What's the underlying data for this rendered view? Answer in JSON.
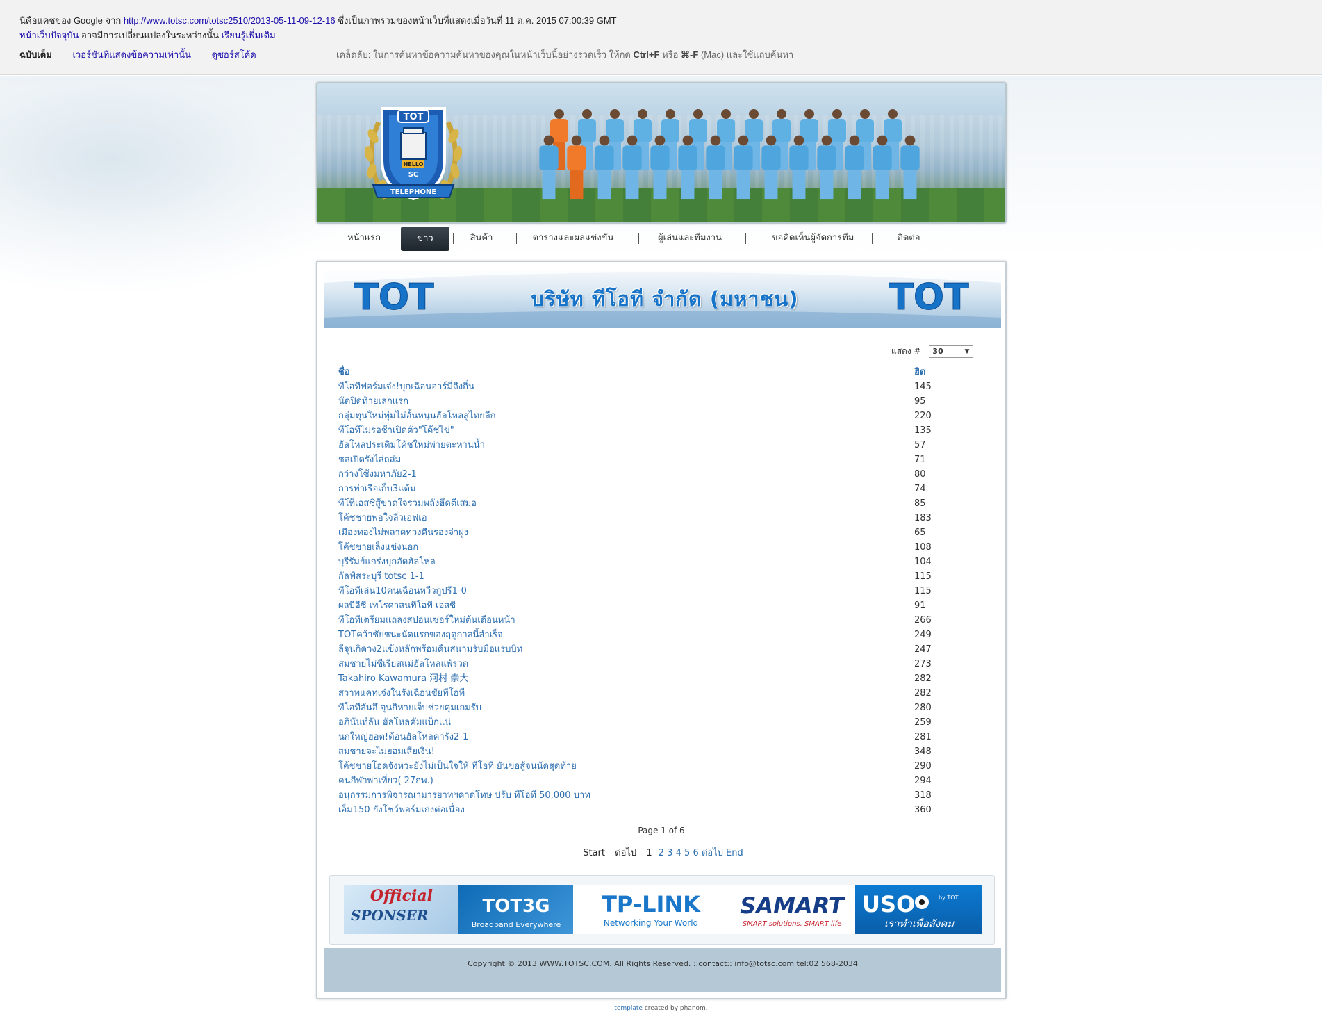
{
  "cache": {
    "prefix": "นี่คือแคชของ Google จาก",
    "url": "http://www.totsc.com/totsc2510/2013-05-11-09-12-16",
    "suffix": "ซึ่งเป็นภาพรวมของหน้าเว็บที่แสดงเมื่อวันที่ 11 ต.ค. 2015 07:00:39 GMT",
    "current_page_link": "หน้าเว็บปัจจุบัน",
    "current_page_text": "อาจมีการเปลี่ยนแปลงในระหว่างนั้น",
    "learn_more": "เรียนรู้เพิ่มเติม",
    "tabs": [
      "ฉบับเต็ม",
      "เวอร์ชันที่แสดงข้อความเท่านั้น",
      "ดูซอร์สโค้ด"
    ],
    "tip_prefix": "เคล็ดลับ: ในการค้นหาข้อความค้นหาของคุณในหน้าเว็บนี้อย่างรวดเร็ว ให้กด",
    "tip_key1": "Ctrl+F",
    "tip_or": "หรือ",
    "tip_key2": "⌘-F",
    "tip_suffix": "(Mac) และใช้แถบค้นหา"
  },
  "banner": {
    "logo_top": "TOT",
    "logo_mid1": "HELLO",
    "logo_mid2": "SC",
    "logo_ribbon": "TELEPHONE"
  },
  "nav": {
    "items": [
      "หน้าแรก",
      "ข่าว",
      "สินค้า",
      "ตารางและผลแข่งขัน",
      "ผู้เล่นและทีมงาน",
      "ขอคิดเห็นผู้จัดการทีม",
      "ติดต่อ"
    ],
    "active_index": 1
  },
  "header_banner": {
    "title": "บริษัท ทีโอที จำกัด (มหาชน)",
    "logo_left": "TOT",
    "logo_right": "TOT"
  },
  "display": {
    "label": "แสดง #",
    "value": "30"
  },
  "table": {
    "col_title": "ชื่อ",
    "col_hits": "ฮิต",
    "rows": [
      {
        "title": "ทีโอทีฟอร์มเจ๋ง!บุกเฉือนอาร์มี่ถึงถิ่น",
        "hits": "145"
      },
      {
        "title": "นัดปิดท้ายเลกแรก",
        "hits": "95"
      },
      {
        "title": "กลุ่มทุนใหม่ทุ่มไม่อั้นหนุนฮัลโหลสู่ไทยลีก",
        "hits": "220"
      },
      {
        "title": "ทีโอทีไม่รอช้าเปิดตัว\"โค้ชไข่\"",
        "hits": "135"
      },
      {
        "title": "ฮัลโหลประเดิมโค้ชใหม่พ่ายตะหานน้ำ",
        "hits": "57"
      },
      {
        "title": "ชลเปิดรังไล่ถล่ม",
        "hits": "71"
      },
      {
        "title": "กว่างโซ้งมหาภัย2-1",
        "hits": "80"
      },
      {
        "title": "การท่าเรือเก็บ3แต้ม",
        "hits": "74"
      },
      {
        "title": "ทีโท็เอสซีสู้ขาดใจรวมพลังฮึดตีเสมอ",
        "hits": "85"
      },
      {
        "title": "โค้ชชายพอใจลิ่วเอฟเอ",
        "hits": "183"
      },
      {
        "title": "เมืองทองไม่พลาดทวงคืนรองจ่าฝูง",
        "hits": "65"
      },
      {
        "title": "โค้ชชายเล็งแข่งนอก",
        "hits": "108"
      },
      {
        "title": "บุรีรัมย์แกร่งบุกอัดฮัลโหล",
        "hits": "104"
      },
      {
        "title": "กัลฟ์สระบุรี totsc 1-1",
        "hits": "115"
      },
      {
        "title": "ทีโอทีเล่น10คนเฉือนหวีวกูปรี1-0",
        "hits": "115"
      },
      {
        "title": "ผลบีอีซี เทโรศาสนทีโอที เอสซี",
        "hits": "91"
      },
      {
        "title": "ทีโอทีเตรียมแถลงสปอนเซอร์ใหม่ต้นเดือนหน้า",
        "hits": "266"
      },
      {
        "title": "TOTคว้าชัยชนะนัดแรกของฤดูกาลนี้สำเร็จ",
        "hits": "249"
      },
      {
        "title": "ลีจุนกิควง2แข้งหลักพร้อมคืนสนามรับมือแรบบิท",
        "hits": "247"
      },
      {
        "title": "สมชายไม่ซีเรียสแม่ฮัลโหลแพ้รวด",
        "hits": "273"
      },
      {
        "title": "Takahiro Kawamura 河村 崇大",
        "hits": "282"
      },
      {
        "title": "สวาทแคทเจ๋งในรังเฉือนชัยทีโอที",
        "hits": "282"
      },
      {
        "title": "ทีโอทีลันอึ จุนกิหายเจ็บช่วยคุมเกมรับ",
        "hits": "280"
      },
      {
        "title": "อภินันท์ลัน ฮัลโหลคัมแบ็กแน่",
        "hits": "259"
      },
      {
        "title": "นกใหญ่ฮอต!ต้อนฮัลโหลคารัง2-1",
        "hits": "281"
      },
      {
        "title": "สมชายจะไม่ยอมเสียเงิน!",
        "hits": "348"
      },
      {
        "title": "โค้ชชายโอดจังหวะยังไม่เป็นใจให้ ทีโอที ยันขอสู้จนนัดสุดท้าย",
        "hits": "290"
      },
      {
        "title": "คนกีฬาพาเที่ยว( 27กพ.)",
        "hits": "294"
      },
      {
        "title": "อนุกรรมการพิจารณามารยาทฯคาดโทษ ปรับ ทีโอที 50,000 บาท",
        "hits": "318"
      },
      {
        "title": "เอ็ม150 ยังโชว์ฟอร์มเก่งต่อเนื่อง",
        "hits": "360"
      }
    ]
  },
  "pagination": {
    "counter": "Page 1 of 6",
    "start": "Start",
    "prev": "ต่อไป",
    "pages": [
      "1",
      "2",
      "3",
      "4",
      "5",
      "6"
    ],
    "current": "1",
    "next": "ต่อไป",
    "end": "End"
  },
  "sponsors": {
    "official_line1": "Official",
    "official_line2": "SPONSER",
    "tot3g": "TOT3G",
    "tot3g_sub": "Broadband Everywhere",
    "tplink": "TP-LINK",
    "tplink_sub": "Networking Your World",
    "samart": "SAMART",
    "samart_sub": "SMART solutions, SMART life",
    "uso": "USO",
    "uso_by": "by TOT",
    "uso_sub": "เราทำเพื่อสังคม"
  },
  "footer": {
    "copyright": "Copyright © 2013 WWW.TOTSC.COM. All Rights Reserved. ::contact:: info@totsc.com tel:02 568-2034",
    "template_link": "template",
    "template_suffix": "created by phanom."
  },
  "colors": {
    "link": "#2d6fb0",
    "google_link": "#1a0dab",
    "nav_active": "#1e262d",
    "footer_bar": "#b4c8d6",
    "tot_blue": "#1673c8"
  }
}
